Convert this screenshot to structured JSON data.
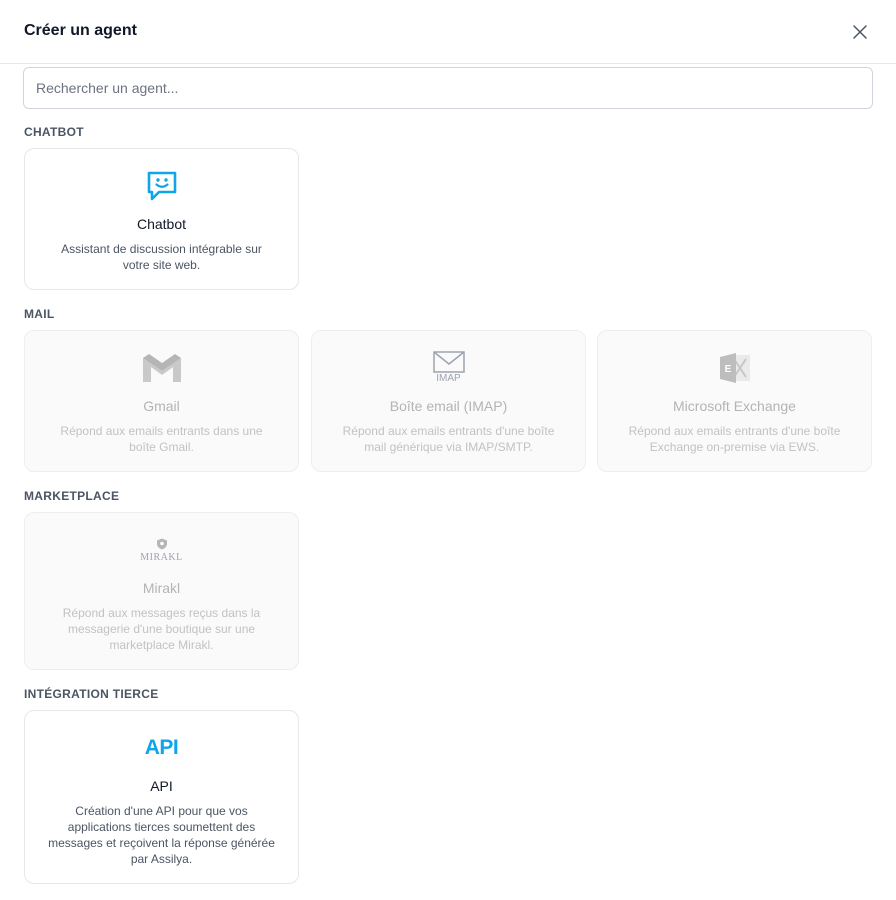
{
  "dialog": {
    "title": "Créer un agent",
    "close_icon": "close-icon"
  },
  "search": {
    "placeholder": "Rechercher un agent...",
    "value": ""
  },
  "colors": {
    "accent": "#0EA5E9",
    "disabled_text": "#B4B4B4"
  },
  "sections": {
    "chatbot": {
      "title": "CHATBOT",
      "cards": [
        {
          "name": "Chatbot",
          "description": "Assistant de discussion intégrable sur votre site web.",
          "icon": "chat-smile-icon",
          "enabled": true
        }
      ]
    },
    "mail": {
      "title": "MAIL",
      "cards": [
        {
          "name": "Gmail",
          "description": "Répond aux emails entrants dans une boîte Gmail.",
          "icon": "gmail-icon",
          "enabled": false
        },
        {
          "name": "Boîte email (IMAP)",
          "description": "Répond aux emails entrants d'une boîte mail générique via IMAP/SMTP.",
          "icon": "imap-envelope-icon",
          "icon_label": "IMAP",
          "enabled": false
        },
        {
          "name": "Microsoft Exchange",
          "description": "Répond aux emails entrants d'une boîte Exchange on-premise via EWS.",
          "icon": "exchange-icon",
          "enabled": false
        }
      ]
    },
    "marketplace": {
      "title": "MARKETPLACE",
      "cards": [
        {
          "name": "Mirakl",
          "description": "Répond aux messages reçus dans la messagerie d'une boutique sur une marketplace Mirakl.",
          "icon": "mirakl-logo-icon",
          "icon_label": "MIRAKL",
          "enabled": false
        }
      ]
    },
    "integration": {
      "title": "INTÉGRATION TIERCE",
      "cards": [
        {
          "name": "API",
          "description": "Création d'une API pour que vos applications tierces soumettent des messages et reçoivent la réponse générée par Assilya.",
          "icon": "api-icon",
          "icon_label": "API",
          "enabled": true
        }
      ]
    }
  }
}
